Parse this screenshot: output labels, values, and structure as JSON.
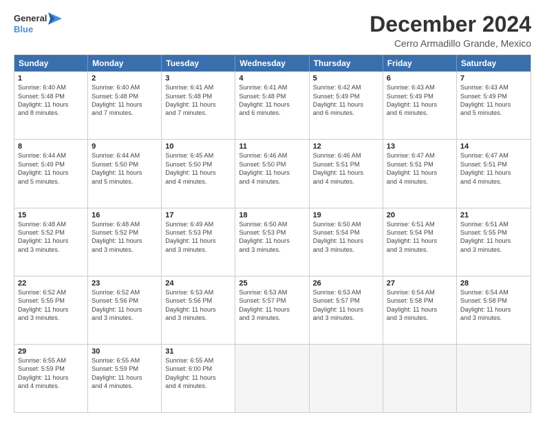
{
  "logo": {
    "line1": "General",
    "line2": "Blue"
  },
  "title": "December 2024",
  "subtitle": "Cerro Armadillo Grande, Mexico",
  "header_days": [
    "Sunday",
    "Monday",
    "Tuesday",
    "Wednesday",
    "Thursday",
    "Friday",
    "Saturday"
  ],
  "weeks": [
    [
      {
        "day": "1",
        "info": "Sunrise: 6:40 AM\nSunset: 5:48 PM\nDaylight: 11 hours\nand 8 minutes."
      },
      {
        "day": "2",
        "info": "Sunrise: 6:40 AM\nSunset: 5:48 PM\nDaylight: 11 hours\nand 7 minutes."
      },
      {
        "day": "3",
        "info": "Sunrise: 6:41 AM\nSunset: 5:48 PM\nDaylight: 11 hours\nand 7 minutes."
      },
      {
        "day": "4",
        "info": "Sunrise: 6:41 AM\nSunset: 5:48 PM\nDaylight: 11 hours\nand 6 minutes."
      },
      {
        "day": "5",
        "info": "Sunrise: 6:42 AM\nSunset: 5:49 PM\nDaylight: 11 hours\nand 6 minutes."
      },
      {
        "day": "6",
        "info": "Sunrise: 6:43 AM\nSunset: 5:49 PM\nDaylight: 11 hours\nand 6 minutes."
      },
      {
        "day": "7",
        "info": "Sunrise: 6:43 AM\nSunset: 5:49 PM\nDaylight: 11 hours\nand 5 minutes."
      }
    ],
    [
      {
        "day": "8",
        "info": "Sunrise: 6:44 AM\nSunset: 5:49 PM\nDaylight: 11 hours\nand 5 minutes."
      },
      {
        "day": "9",
        "info": "Sunrise: 6:44 AM\nSunset: 5:50 PM\nDaylight: 11 hours\nand 5 minutes."
      },
      {
        "day": "10",
        "info": "Sunrise: 6:45 AM\nSunset: 5:50 PM\nDaylight: 11 hours\nand 4 minutes."
      },
      {
        "day": "11",
        "info": "Sunrise: 6:46 AM\nSunset: 5:50 PM\nDaylight: 11 hours\nand 4 minutes."
      },
      {
        "day": "12",
        "info": "Sunrise: 6:46 AM\nSunset: 5:51 PM\nDaylight: 11 hours\nand 4 minutes."
      },
      {
        "day": "13",
        "info": "Sunrise: 6:47 AM\nSunset: 5:51 PM\nDaylight: 11 hours\nand 4 minutes."
      },
      {
        "day": "14",
        "info": "Sunrise: 6:47 AM\nSunset: 5:51 PM\nDaylight: 11 hours\nand 4 minutes."
      }
    ],
    [
      {
        "day": "15",
        "info": "Sunrise: 6:48 AM\nSunset: 5:52 PM\nDaylight: 11 hours\nand 3 minutes."
      },
      {
        "day": "16",
        "info": "Sunrise: 6:48 AM\nSunset: 5:52 PM\nDaylight: 11 hours\nand 3 minutes."
      },
      {
        "day": "17",
        "info": "Sunrise: 6:49 AM\nSunset: 5:53 PM\nDaylight: 11 hours\nand 3 minutes."
      },
      {
        "day": "18",
        "info": "Sunrise: 6:50 AM\nSunset: 5:53 PM\nDaylight: 11 hours\nand 3 minutes."
      },
      {
        "day": "19",
        "info": "Sunrise: 6:50 AM\nSunset: 5:54 PM\nDaylight: 11 hours\nand 3 minutes."
      },
      {
        "day": "20",
        "info": "Sunrise: 6:51 AM\nSunset: 5:54 PM\nDaylight: 11 hours\nand 3 minutes."
      },
      {
        "day": "21",
        "info": "Sunrise: 6:51 AM\nSunset: 5:55 PM\nDaylight: 11 hours\nand 3 minutes."
      }
    ],
    [
      {
        "day": "22",
        "info": "Sunrise: 6:52 AM\nSunset: 5:55 PM\nDaylight: 11 hours\nand 3 minutes."
      },
      {
        "day": "23",
        "info": "Sunrise: 6:52 AM\nSunset: 5:56 PM\nDaylight: 11 hours\nand 3 minutes."
      },
      {
        "day": "24",
        "info": "Sunrise: 6:53 AM\nSunset: 5:56 PM\nDaylight: 11 hours\nand 3 minutes."
      },
      {
        "day": "25",
        "info": "Sunrise: 6:53 AM\nSunset: 5:57 PM\nDaylight: 11 hours\nand 3 minutes."
      },
      {
        "day": "26",
        "info": "Sunrise: 6:53 AM\nSunset: 5:57 PM\nDaylight: 11 hours\nand 3 minutes."
      },
      {
        "day": "27",
        "info": "Sunrise: 6:54 AM\nSunset: 5:58 PM\nDaylight: 11 hours\nand 3 minutes."
      },
      {
        "day": "28",
        "info": "Sunrise: 6:54 AM\nSunset: 5:58 PM\nDaylight: 11 hours\nand 3 minutes."
      }
    ],
    [
      {
        "day": "29",
        "info": "Sunrise: 6:55 AM\nSunset: 5:59 PM\nDaylight: 11 hours\nand 4 minutes."
      },
      {
        "day": "30",
        "info": "Sunrise: 6:55 AM\nSunset: 5:59 PM\nDaylight: 11 hours\nand 4 minutes."
      },
      {
        "day": "31",
        "info": "Sunrise: 6:55 AM\nSunset: 6:00 PM\nDaylight: 11 hours\nand 4 minutes."
      },
      {
        "day": "",
        "info": ""
      },
      {
        "day": "",
        "info": ""
      },
      {
        "day": "",
        "info": ""
      },
      {
        "day": "",
        "info": ""
      }
    ]
  ]
}
